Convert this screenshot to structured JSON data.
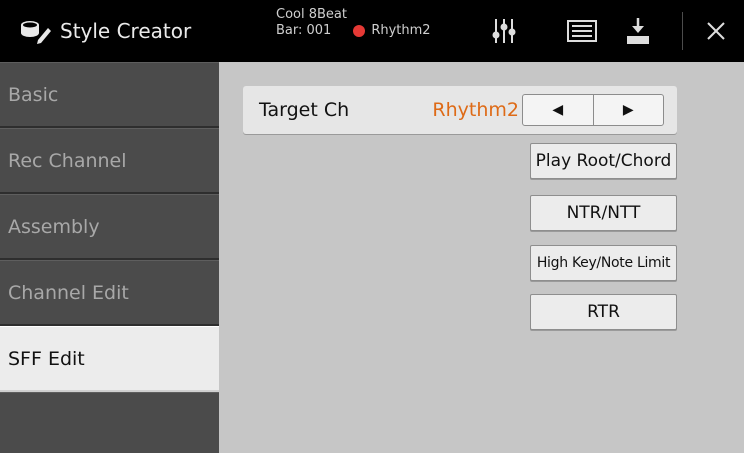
{
  "header": {
    "title": "Style Creator",
    "song_name": "Cool 8Beat",
    "bar_label": "Bar: 001",
    "record_channel": "Rhythm2",
    "icons": [
      "style-creator-logo-icon",
      "mixer-icon",
      "list-icon",
      "save-icon",
      "close-icon"
    ]
  },
  "sidebar": {
    "items": [
      {
        "label": "Basic",
        "active": false
      },
      {
        "label": "Rec Channel",
        "active": false
      },
      {
        "label": "Assembly",
        "active": false
      },
      {
        "label": "Channel Edit",
        "active": false
      },
      {
        "label": "SFF Edit",
        "active": true
      }
    ]
  },
  "main": {
    "target_label": "Target Ch",
    "target_value": "Rhythm2",
    "prev_symbol": "◀",
    "next_symbol": "▶",
    "buttons": [
      {
        "label": "Play Root/Chord"
      },
      {
        "label": "NTR/NTT"
      },
      {
        "label": "High Key/Note Limit"
      },
      {
        "label": "RTR"
      }
    ]
  },
  "colors": {
    "accent": "#de6a16",
    "record": "#e53935",
    "topbar": "#000000",
    "sidebar": "#4b4b4b",
    "active_tab": "#ececec",
    "background": "#c6c6c6"
  }
}
